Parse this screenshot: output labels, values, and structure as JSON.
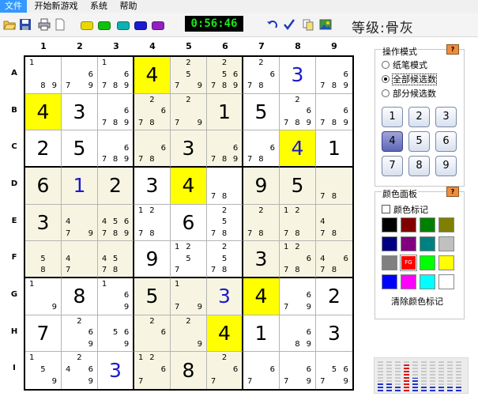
{
  "menu": [
    "文件",
    "开始新游戏",
    "系统",
    "帮助"
  ],
  "toolbar": {
    "timer": "0:56:46",
    "level": "等级:骨灰",
    "color_pills": [
      "#e8d800",
      "#10c010",
      "#10b0b0",
      "#1a1ad0",
      "#9020c0"
    ]
  },
  "board": {
    "columns": [
      "1",
      "2",
      "3",
      "4",
      "5",
      "6",
      "7",
      "8",
      "9"
    ],
    "rows": [
      "A",
      "B",
      "C",
      "D",
      "E",
      "F",
      "G",
      "H",
      "I"
    ],
    "cells": [
      [
        {
          "c": "1 89"
        },
        {
          "c": "7 69"
        },
        {
          "c": "1 6789"
        },
        {
          "v": "4",
          "bg": "yel"
        },
        {
          "c": "25 7 9",
          "bg": "cream"
        },
        {
          "c": "256789",
          "bg": "cream"
        },
        {
          "c": "2 678"
        },
        {
          "v": "3",
          "blue": true
        },
        {
          "c": "6789"
        }
      ],
      [
        {
          "v": "4",
          "bg": "yel"
        },
        {
          "v": "3"
        },
        {
          "c": "6789"
        },
        {
          "c": "2 678",
          "bg": "cream"
        },
        {
          "c": "27 9",
          "bg": "cream"
        },
        {
          "v": "1",
          "bg": "cream"
        },
        {
          "v": "5"
        },
        {
          "c": "2 6789"
        },
        {
          "c": "6789"
        }
      ],
      [
        {
          "v": "2"
        },
        {
          "v": "5"
        },
        {
          "c": "6789"
        },
        {
          "c": "678",
          "bg": "cream"
        },
        {
          "v": "3",
          "bg": "cream"
        },
        {
          "c": "6789",
          "bg": "cream"
        },
        {
          "c": "678"
        },
        {
          "v": "4",
          "blue": true,
          "bg": "yel"
        },
        {
          "v": "1"
        }
      ],
      [
        {
          "v": "6",
          "bg": "cream"
        },
        {
          "v": "1",
          "blue": true,
          "bg": "cream"
        },
        {
          "v": "2",
          "bg": "cream"
        },
        {
          "v": "3"
        },
        {
          "v": "4",
          "bg": "yel"
        },
        {
          "c": "78"
        },
        {
          "v": "9",
          "bg": "cream"
        },
        {
          "v": "5",
          "bg": "cream"
        },
        {
          "c": "78",
          "bg": "cream"
        }
      ],
      [
        {
          "v": "3",
          "bg": "cream"
        },
        {
          "c": "47 9",
          "bg": "cream"
        },
        {
          "c": "456789",
          "bg": "cream"
        },
        {
          "c": "12 78"
        },
        {
          "v": "6"
        },
        {
          "c": "2 5 78"
        },
        {
          "c": "2 78",
          "bg": "cream"
        },
        {
          "c": "12 78",
          "bg": "cream"
        },
        {
          "c": "478",
          "bg": "cream"
        }
      ],
      [
        {
          "c": "5 8",
          "bg": "cream"
        },
        {
          "c": "47",
          "bg": "cream"
        },
        {
          "c": "45 78",
          "bg": "cream"
        },
        {
          "v": "9"
        },
        {
          "c": "12 5 7"
        },
        {
          "c": "2 5 78"
        },
        {
          "v": "3",
          "bg": "cream"
        },
        {
          "c": "12 678",
          "bg": "cream"
        },
        {
          "c": "46 78",
          "bg": "cream"
        }
      ],
      [
        {
          "c": "1 9"
        },
        {
          "v": "8"
        },
        {
          "c": "1 6 9"
        },
        {
          "v": "5",
          "bg": "cream"
        },
        {
          "c": "17 9",
          "bg": "cream"
        },
        {
          "v": "3",
          "blue": true,
          "bg": "cream"
        },
        {
          "v": "4",
          "bg": "yel"
        },
        {
          "c": "679"
        },
        {
          "v": "2"
        }
      ],
      [
        {
          "v": "7"
        },
        {
          "c": "2 6 9"
        },
        {
          "c": "569"
        },
        {
          "c": "2 6",
          "bg": "cream"
        },
        {
          "c": "2 9",
          "bg": "cream"
        },
        {
          "v": "4",
          "bg": "yel"
        },
        {
          "v": "1"
        },
        {
          "c": "6 89"
        },
        {
          "v": "3"
        }
      ],
      [
        {
          "c": "1 5 9"
        },
        {
          "c": "4 2 6 9"
        },
        {
          "v": "3",
          "blue": true
        },
        {
          "c": "12 67",
          "bg": "cream"
        },
        {
          "v": "8",
          "bg": "cream"
        },
        {
          "c": "2 67",
          "bg": "cream"
        },
        {
          "c": "7 6"
        },
        {
          "c": "679"
        },
        {
          "c": "5679"
        }
      ]
    ]
  },
  "mode_panel": {
    "title": "操作模式",
    "help": "?",
    "options": [
      "纸笔模式",
      "全部候选数",
      "部分候选数"
    ],
    "selected": 1,
    "number_buttons": [
      "1",
      "2",
      "3",
      "4",
      "5",
      "6",
      "7",
      "8",
      "9"
    ],
    "active_number": "4"
  },
  "color_panel": {
    "title": "颜色面板",
    "help": "?",
    "checkbox_label": "颜色标记",
    "swatches": [
      "#000000",
      "#800000",
      "#008000",
      "#808000",
      "#000080",
      "#800080",
      "#008080",
      "#c0c0c0",
      "#808080",
      "#ff0000",
      "#00ff00",
      "#ffff00",
      "#0000ff",
      "#ff00ff",
      "#00ffff",
      "#ffffff"
    ],
    "fg_label": "FG",
    "clear_label": "清除颜色标记"
  },
  "meter": {
    "levels": [
      0.25,
      0.3,
      0.15,
      0.95,
      0.45,
      0.2,
      0.2,
      0.2,
      0.2,
      0.2
    ],
    "peak_index": 3
  }
}
